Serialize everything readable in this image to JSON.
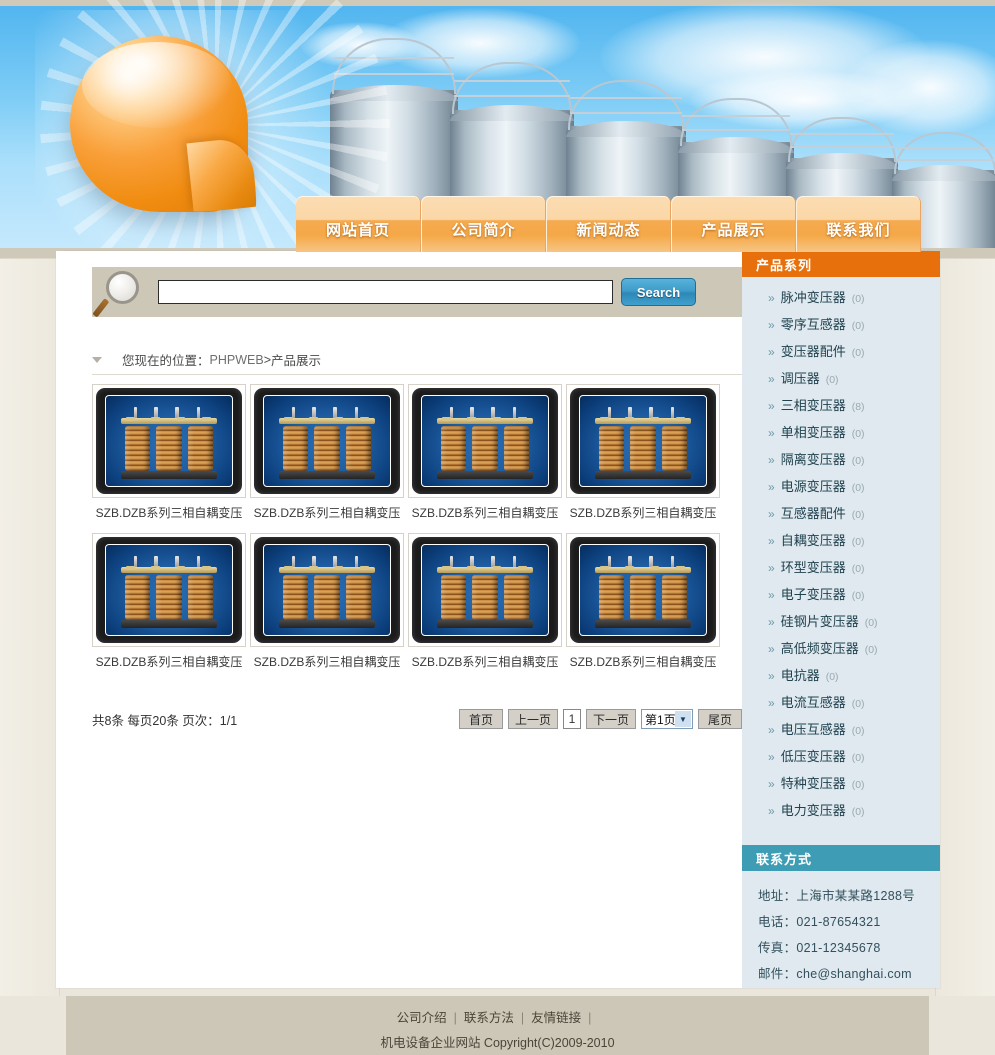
{
  "nav": {
    "items": [
      {
        "label": "网站首页",
        "name": "nav-home"
      },
      {
        "label": "公司简介",
        "name": "nav-about"
      },
      {
        "label": "新闻动态",
        "name": "nav-news"
      },
      {
        "label": "产品展示",
        "name": "nav-products"
      },
      {
        "label": "联系我们",
        "name": "nav-contact"
      }
    ]
  },
  "search": {
    "value": "",
    "placeholder": "",
    "button_label": "Search",
    "icon": "magnifier-icon"
  },
  "breadcrumb": {
    "prefix": "您现在的位置：",
    "root": "PHPWEB",
    "separator": " > ",
    "current": "产品展示"
  },
  "products": [
    {
      "caption": "SZB.DZB系列三相自耦变压"
    },
    {
      "caption": "SZB.DZB系列三相自耦变压"
    },
    {
      "caption": "SZB.DZB系列三相自耦变压"
    },
    {
      "caption": "SZB.DZB系列三相自耦变压"
    },
    {
      "caption": "SZB.DZB系列三相自耦变压"
    },
    {
      "caption": "SZB.DZB系列三相自耦变压"
    },
    {
      "caption": "SZB.DZB系列三相自耦变压"
    },
    {
      "caption": "SZB.DZB系列三相自耦变压"
    }
  ],
  "pagination": {
    "info": "共8条 每页20条 页次：1/1",
    "first": "首页",
    "prev": "上一页",
    "current": "1",
    "next": "下一页",
    "select_value": "第1页",
    "last": "尾页"
  },
  "sidebar": {
    "products_header": "产品系列",
    "categories": [
      {
        "label": "脉冲变压器",
        "count": "(0)"
      },
      {
        "label": "零序互感器",
        "count": "(0)"
      },
      {
        "label": "变压器配件",
        "count": "(0)"
      },
      {
        "label": "调压器",
        "count": "(0)"
      },
      {
        "label": "三相变压器",
        "count": "(8)"
      },
      {
        "label": "单相变压器",
        "count": "(0)"
      },
      {
        "label": "隔离变压器",
        "count": "(0)"
      },
      {
        "label": "电源变压器",
        "count": "(0)"
      },
      {
        "label": "互感器配件",
        "count": "(0)"
      },
      {
        "label": "自耦变压器",
        "count": "(0)"
      },
      {
        "label": "环型变压器",
        "count": "(0)"
      },
      {
        "label": "电子变压器",
        "count": "(0)"
      },
      {
        "label": "硅钢片变压器",
        "count": "(0)"
      },
      {
        "label": "高低频变压器",
        "count": "(0)"
      },
      {
        "label": "电抗器",
        "count": "(0)"
      },
      {
        "label": "电流互感器",
        "count": "(0)"
      },
      {
        "label": "电压互感器",
        "count": "(0)"
      },
      {
        "label": "低压变压器",
        "count": "(0)"
      },
      {
        "label": "特种变压器",
        "count": "(0)"
      },
      {
        "label": "电力变压器",
        "count": "(0)"
      }
    ],
    "contact_header": "联系方式",
    "contact_lines": [
      "地址：上海市某某路1288号",
      "电话：021-87654321",
      "传真：021-12345678",
      "邮件：che@shanghai.com"
    ]
  },
  "footer": {
    "links": [
      "公司介绍",
      "联系方法",
      "友情链接"
    ],
    "copyright": "机电设备企业网站  Copyright(C)2009-2010"
  },
  "colors": {
    "nav_orange": "#f5a847",
    "sidebar_header_orange": "#e8700c",
    "contact_header_teal": "#3e9db5",
    "search_button_blue": "#3f9cc9",
    "sidebar_bg": "#dfe9ef",
    "footer_bg": "#cdc7b8",
    "page_bg": "#eae6dc"
  }
}
